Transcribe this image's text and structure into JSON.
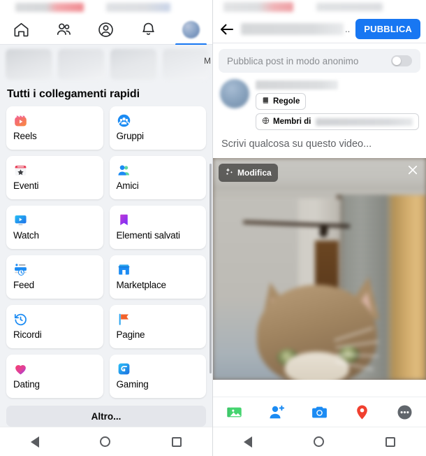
{
  "left": {
    "nav": [
      {
        "name": "home",
        "icon": "home-icon",
        "active": false
      },
      {
        "name": "friends",
        "icon": "friends-icon",
        "active": false
      },
      {
        "name": "profile",
        "icon": "profile-icon",
        "active": false
      },
      {
        "name": "notifications",
        "icon": "bell-icon",
        "active": false
      },
      {
        "name": "menu",
        "icon": "menu-avatar-icon",
        "active": true
      }
    ],
    "shortcuts_heading": "Tutti i collegamenti rapidi",
    "strip_overflow": "M",
    "tiles": [
      {
        "label": "Reels",
        "icon": "reels-icon"
      },
      {
        "label": "Gruppi",
        "icon": "groups-icon"
      },
      {
        "label": "Eventi",
        "icon": "events-icon"
      },
      {
        "label": "Amici",
        "icon": "friends-icon"
      },
      {
        "label": "Watch",
        "icon": "watch-icon"
      },
      {
        "label": "Elementi salvati",
        "icon": "saved-icon"
      },
      {
        "label": "Feed",
        "icon": "feed-icon"
      },
      {
        "label": "Marketplace",
        "icon": "marketplace-icon"
      },
      {
        "label": "Ricordi",
        "icon": "memories-icon"
      },
      {
        "label": "Pagine",
        "icon": "pages-icon"
      },
      {
        "label": "Dating",
        "icon": "dating-icon"
      },
      {
        "label": "Gaming",
        "icon": "gaming-icon"
      }
    ],
    "more_label": "Altro..."
  },
  "right": {
    "header": {
      "back_icon": "back-arrow-icon",
      "title_dots": "..",
      "publish_label": "PUBBLICA"
    },
    "anonymous": {
      "label": "Pubblica post in modo anonimo",
      "enabled": false
    },
    "composer": {
      "rules_chip": "Regole",
      "rules_icon": "book-icon",
      "members_chip": "Membri di",
      "members_icon": "globe-icon",
      "placeholder": "Scrivi qualcosa su questo video..."
    },
    "video": {
      "edit_label": "Modifica",
      "edit_icon": "sparkle-icon",
      "close_icon": "close-icon"
    },
    "toolbar": [
      {
        "name": "photo-video",
        "icon": "photo-icon"
      },
      {
        "name": "tag-people",
        "icon": "tag-person-icon"
      },
      {
        "name": "camera",
        "icon": "camera-icon"
      },
      {
        "name": "location",
        "icon": "location-pin-icon"
      },
      {
        "name": "more-options",
        "icon": "more-dots-icon"
      }
    ]
  },
  "colors": {
    "accent": "#1877f2",
    "page_bg": "#f0f2f5",
    "card": "#ffffff",
    "text": "#050505",
    "muted": "#8a8d91"
  }
}
